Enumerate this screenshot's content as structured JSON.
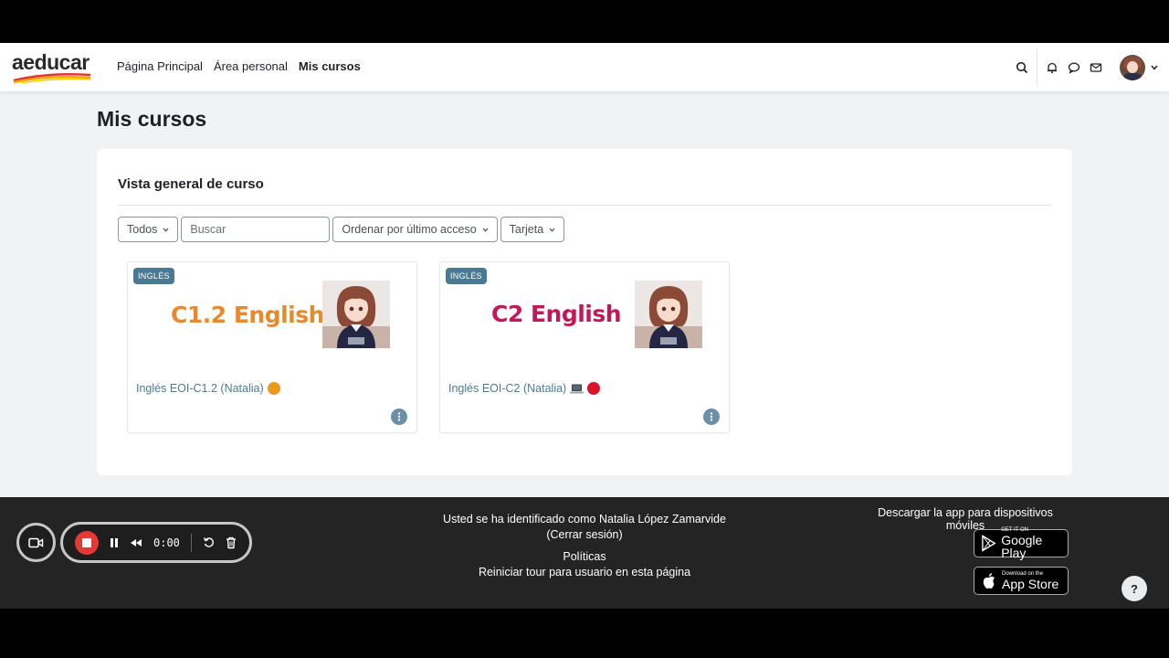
{
  "navbar": {
    "logo_text": "aeducar",
    "links": [
      "Página Principal",
      "Área personal",
      "Mis cursos"
    ],
    "active_link": "Mis cursos"
  },
  "page": {
    "title": "Mis cursos"
  },
  "block": {
    "title": "Vista general de curso",
    "filter_label": "Todos",
    "search_placeholder": "Buscar",
    "sort_label": "Ordenar por último acceso",
    "view_label": "Tarjeta"
  },
  "courses": [
    {
      "category": "INGLÉS",
      "image_text": "C1.2 English",
      "image_text_color": "#e8892c",
      "name": "Inglés EOI-C1.2 (Natalia)"
    },
    {
      "category": "INGLÉS",
      "image_text": "C2 English",
      "image_text_color": "#c2185b",
      "name": "Inglés EOI-C2 (Natalia)"
    }
  ],
  "footer": {
    "logged_in_text": "Usted se ha identificado como Natalia López Zamarvide",
    "logout_text": "(Cerrar sesión)",
    "policies": "Políticas",
    "tour": "Reiniciar tour para usuario en esta página",
    "app_title": "Descargar la app para dispositivos móviles",
    "google_small": "GET IT ON",
    "google_large": "Google Play",
    "apple_small": "Download on the",
    "apple_large": "App Store",
    "help": "?"
  },
  "recorder": {
    "time": "0:00"
  },
  "colors": {
    "link": "#4a7a93",
    "badge": "#4a7a93",
    "footer_bg": "#242424",
    "page_bg": "#f0f2f4"
  },
  "icons": [
    "search-icon",
    "bell-icon",
    "chat-icon",
    "mail-icon",
    "chevron-down-icon",
    "kebab-icon",
    "camera-icon",
    "pause-icon",
    "rewind-icon",
    "restart-icon",
    "trash-icon"
  ]
}
